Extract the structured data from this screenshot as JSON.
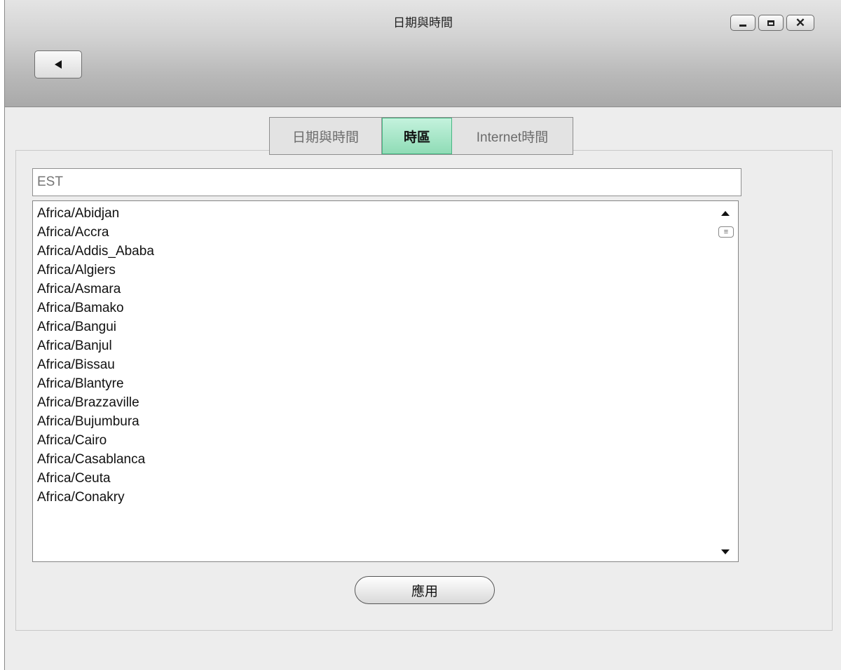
{
  "window": {
    "title": "日期與時間"
  },
  "tabs": [
    {
      "label": "日期與時間",
      "active": false
    },
    {
      "label": "時區",
      "active": true
    },
    {
      "label": "Internet時間",
      "active": false
    }
  ],
  "search": {
    "value": "",
    "placeholder": "EST"
  },
  "timezones": [
    "Africa/Abidjan",
    "Africa/Accra",
    "Africa/Addis_Ababa",
    "Africa/Algiers",
    "Africa/Asmara",
    "Africa/Bamako",
    "Africa/Bangui",
    "Africa/Banjul",
    "Africa/Bissau",
    "Africa/Blantyre",
    "Africa/Brazzaville",
    "Africa/Bujumbura",
    "Africa/Cairo",
    "Africa/Casablanca",
    "Africa/Ceuta",
    "Africa/Conakry"
  ],
  "apply_button": {
    "label": "應用"
  },
  "colors": {
    "active_tab": "#8fdcb6",
    "titlebar": "#b9b9b9",
    "background": "#ededed"
  }
}
